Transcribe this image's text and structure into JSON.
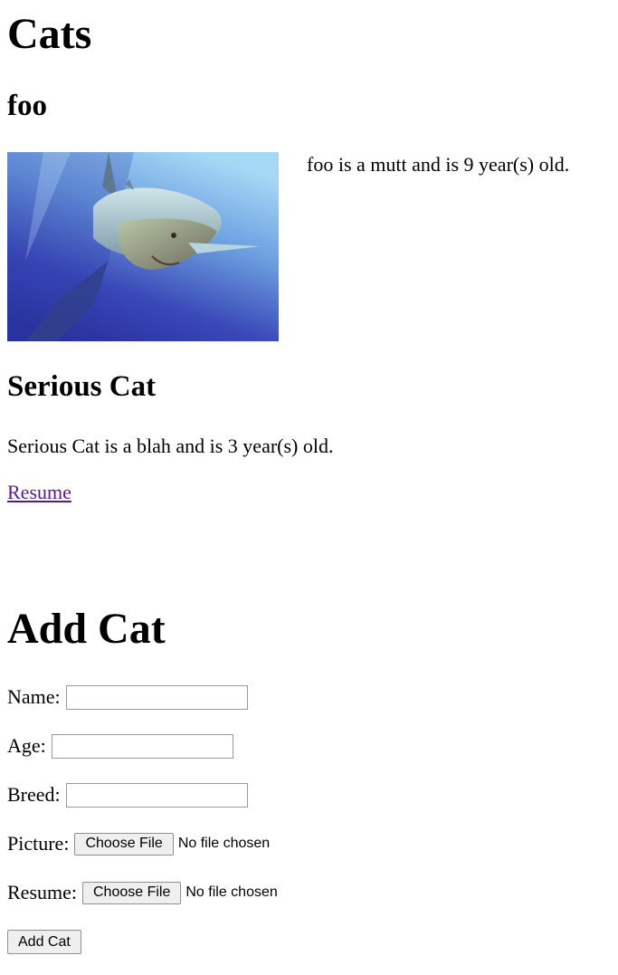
{
  "cats_heading": "Cats",
  "cats": [
    {
      "name": "foo",
      "description": "foo is a mutt and is 9 year(s) old.",
      "has_picture": true
    },
    {
      "name": "Serious Cat",
      "description": "Serious Cat is a blah and is 3 year(s) old.",
      "resume_link": "Resume"
    }
  ],
  "form": {
    "heading": "Add Cat",
    "name_label": "Name:",
    "name_value": "",
    "age_label": "Age:",
    "age_value": "",
    "breed_label": "Breed:",
    "breed_value": "",
    "picture_label": "Picture:",
    "picture_button": "Choose File",
    "picture_status": "No file chosen",
    "resume_label": "Resume:",
    "resume_button": "Choose File",
    "resume_status": "No file chosen",
    "submit_label": "Add Cat"
  },
  "colors": {
    "link": "#551a8b",
    "photo_water_light": "#8fc7ee",
    "photo_water_dark": "#2630a0"
  }
}
